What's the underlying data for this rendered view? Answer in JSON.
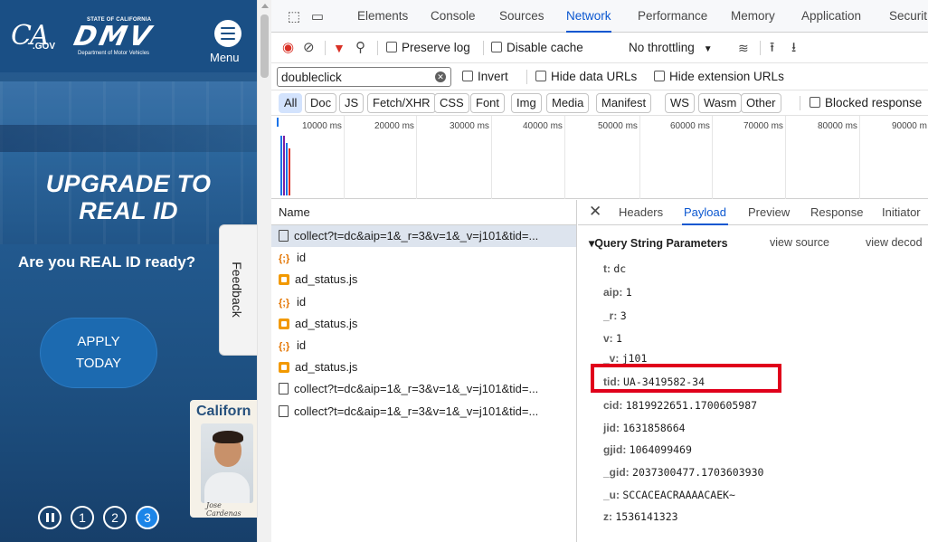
{
  "site": {
    "ca_gov": "CA",
    "ca_gov_sub": ".GOV",
    "state_label": "STATE OF CALIFORNIA",
    "dmv_logo": "DMV",
    "dmv_dept": "Department of Motor Vehicles",
    "menu_label": "Menu",
    "headline_line1": "UPGRADE TO",
    "headline_line2": "REAL ID",
    "subheadline": "Are you REAL ID ready?",
    "apply_line1": "APPLY",
    "apply_line2": "TODAY",
    "feedback": "Feedback",
    "license_title": "Californ",
    "license_signature": "Jose Cardenas",
    "carousel": [
      "1",
      "2",
      "3"
    ],
    "carousel_active": "3"
  },
  "devtools": {
    "tabs": [
      "Elements",
      "Console",
      "Sources",
      "Network",
      "Performance",
      "Memory",
      "Application",
      "Securit"
    ],
    "active_tab": "Network",
    "toolbar": {
      "preserve_log": "Preserve log",
      "disable_cache": "Disable cache",
      "throttling": "No throttling"
    },
    "filter": {
      "value": "doubleclick",
      "invert": "Invert",
      "hide_data_urls": "Hide data URLs",
      "hide_extension_urls": "Hide extension URLs"
    },
    "types": [
      "All",
      "Doc",
      "JS",
      "Fetch/XHR",
      "CSS",
      "Font",
      "Img",
      "Media",
      "Manifest",
      "WS",
      "Wasm",
      "Other"
    ],
    "blocked_response": "Blocked response",
    "timeline_ticks": [
      "10000 ms",
      "20000 ms",
      "30000 ms",
      "40000 ms",
      "50000 ms",
      "60000 ms",
      "70000 ms",
      "80000 ms",
      "90000 m"
    ],
    "requests_header": "Name",
    "requests": [
      {
        "type": "doc",
        "name": "collect?t=dc&aip=1&_r=3&v=1&_v=j101&tid=..."
      },
      {
        "type": "json",
        "name": "id"
      },
      {
        "type": "js",
        "name": "ad_status.js"
      },
      {
        "type": "json",
        "name": "id"
      },
      {
        "type": "js",
        "name": "ad_status.js"
      },
      {
        "type": "json",
        "name": "id"
      },
      {
        "type": "js",
        "name": "ad_status.js"
      },
      {
        "type": "doc",
        "name": "collect?t=dc&aip=1&_r=3&v=1&_v=j101&tid=..."
      },
      {
        "type": "doc",
        "name": "collect?t=dc&aip=1&_r=3&v=1&_v=j101&tid=..."
      }
    ],
    "detail_tabs": [
      "Headers",
      "Payload",
      "Preview",
      "Response",
      "Initiator"
    ],
    "active_detail_tab": "Payload",
    "query_section": "▾Query String Parameters",
    "view_source": "view source",
    "view_decoded": "view decod",
    "params": [
      {
        "k": "t:",
        "v": "dc"
      },
      {
        "k": "aip:",
        "v": "1"
      },
      {
        "k": "_r:",
        "v": "3"
      },
      {
        "k": "v:",
        "v": "1"
      },
      {
        "k": "_v:",
        "v": "j101"
      },
      {
        "k": "tid:",
        "v": "UA-3419582-34"
      },
      {
        "k": "cid:",
        "v": "1819922651.1700605987"
      },
      {
        "k": "jid:",
        "v": "1631858664"
      },
      {
        "k": "gjid:",
        "v": "1064099469"
      },
      {
        "k": "_gid:",
        "v": "2037300477.1703603930"
      },
      {
        "k": "_u:",
        "v": "SCCACEACRAAAACAEK~"
      },
      {
        "k": "z:",
        "v": "1536141323"
      }
    ],
    "highlight_color": "#e0001b",
    "accent_color": "#0b57d0"
  }
}
